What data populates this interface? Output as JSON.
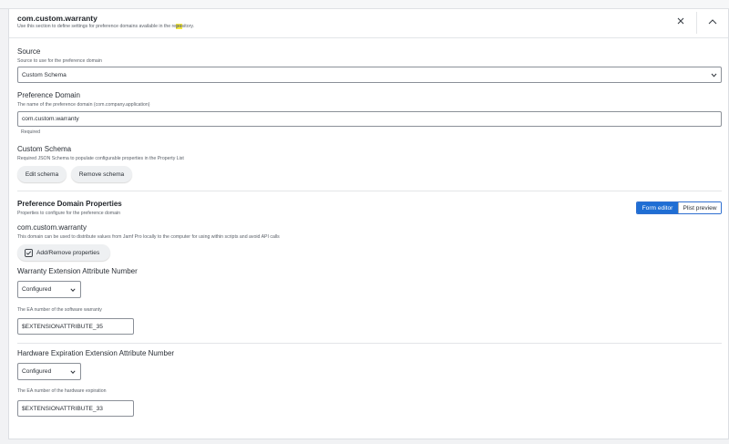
{
  "header": {
    "title": "com.custom.warranty",
    "subtitle_before": "Use this section to define settings for preference domains available in the re",
    "subtitle_highlight": "po",
    "subtitle_after": "sitory."
  },
  "source": {
    "label": "Source",
    "help": "Source to use for the preference domain",
    "selected": "Custom Schema"
  },
  "preference_domain": {
    "label": "Preference Domain",
    "help": "The name of the preference domain (com.company.application)",
    "value": "com.custom.warranty",
    "required": "Required"
  },
  "custom_schema": {
    "label": "Custom Schema",
    "help": "Required JSON Schema to populate configurable properties in the Property List",
    "edit_label": "Edit schema",
    "remove_label": "Remove schema"
  },
  "properties": {
    "label": "Preference Domain Properties",
    "help": "Properties to configure for the preference domain",
    "tabs": [
      "Form editor",
      "Plist preview"
    ],
    "active_tab": "Form editor",
    "domain_name": "com.custom.warranty",
    "domain_desc": "This domain can be used to distribute values from Jamf Pro locally to the computer for using within scripts and avoid API calls",
    "add_remove_label": "Add/Remove properties"
  },
  "fields": [
    {
      "label": "Warranty Extension Attribute Number",
      "state": "Configured",
      "help": "The EA number of the software warranty",
      "value": "$EXTENSIONATTRIBUTE_35"
    },
    {
      "label": "Hardware Expiration Extension Attribute Number",
      "state": "Configured",
      "help": "The EA number of the hardware expiration",
      "value": "$EXTENSIONATTRIBUTE_33"
    }
  ],
  "icons": {
    "close": "close-icon",
    "collapse": "chevron-up-icon",
    "dropdown": "chevron-down-icon",
    "checklist": "checkbox-list-icon"
  },
  "colors": {
    "accent": "#1f6ed4",
    "highlight": "#f5ea3c"
  }
}
